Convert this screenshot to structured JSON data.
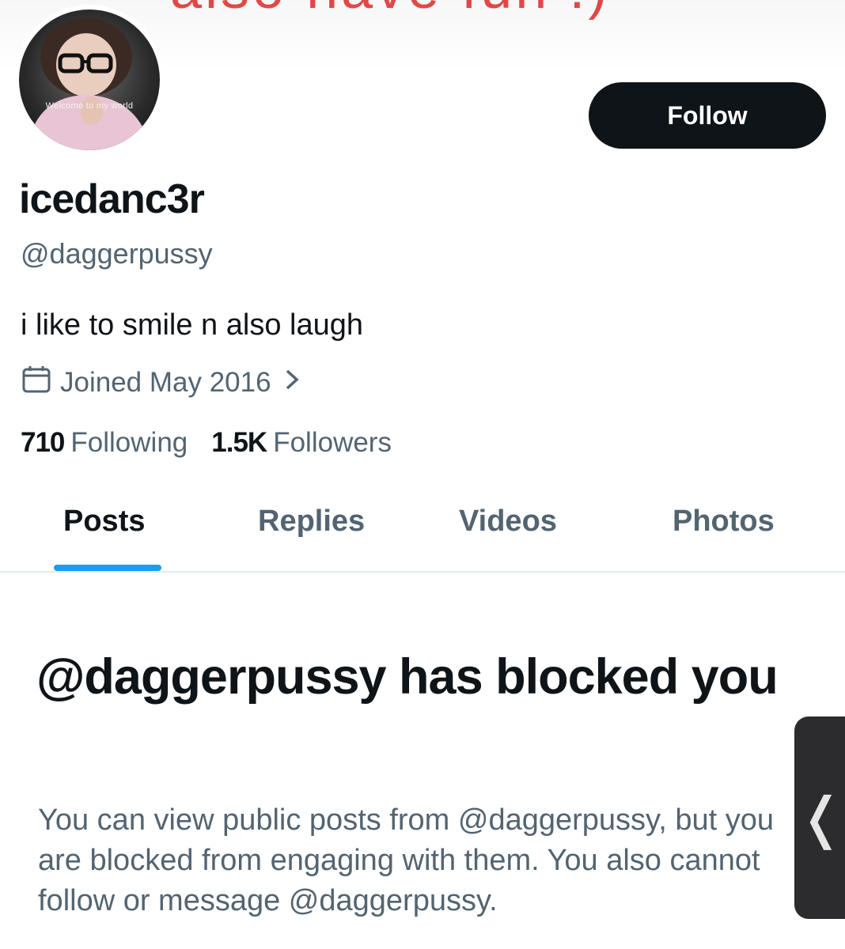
{
  "banner": {
    "text": "also have fun :)"
  },
  "avatar": {
    "caption": "Welcome to my world"
  },
  "profile": {
    "follow_label": "Follow",
    "display_name": "icedanc3r",
    "handle": "@daggerpussy",
    "bio": "i like to smile n also laugh",
    "joined": "Joined May 2016",
    "following_count": "710",
    "following_label": "Following",
    "followers_count": "1.5K",
    "followers_label": "Followers"
  },
  "tabs": [
    {
      "label": "Posts",
      "active": true
    },
    {
      "label": "Replies",
      "active": false
    },
    {
      "label": "Videos",
      "active": false
    },
    {
      "label": "Photos",
      "active": false
    }
  ],
  "blocked": {
    "title": "@daggerpussy has blocked you",
    "body": "You can view public posts from @daggerpussy, but you are blocked from engaging with them. You also cannot follow or message @daggerpussy."
  },
  "side_handle": {
    "icon": "chevron-left-icon",
    "glyph": "❬"
  },
  "colors": {
    "text_primary": "#0f1419",
    "text_secondary": "#536471",
    "accent": "#1d9bf0",
    "banner_text": "#e04848"
  }
}
